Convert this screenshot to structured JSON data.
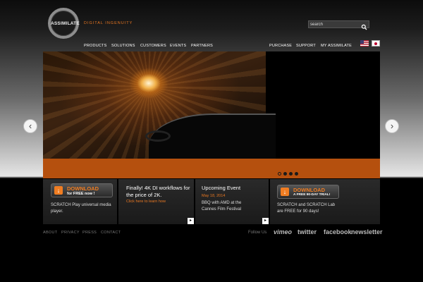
{
  "header": {
    "logo_text": "ASSIMILATE",
    "tagline": "DIGITAL INGENUITY",
    "search": {
      "placeholder": "search",
      "value": ""
    }
  },
  "nav": {
    "left": [
      "PRODUCTS",
      "SOLUTIONS",
      "CUSTOMERS",
      "EVENTS",
      "PARTNERS"
    ],
    "right": [
      "PURCHASE",
      "SUPPORT",
      "MY ASSIMILATE"
    ]
  },
  "slider": {
    "dots_count": 4,
    "active_dot": 0
  },
  "panels": {
    "play": {
      "button_line1": "DOWNLOAD",
      "button_line2": "for FREE now !",
      "text": "SCRATCH Play universal media player."
    },
    "news": {
      "title": "Finally! 4K DI workflows for the price of 2K.",
      "link": "Click here to learn how"
    },
    "event": {
      "title": "Upcoming Event",
      "date": "May 18, 2014",
      "text": "BBQ with AMD at the Cannes Film Festival"
    },
    "trial": {
      "button_line1": "DOWNLOAD",
      "button_line2": "A FREE 90-DAY TRIAL!",
      "text": "SCRATCH and SCRATCH Lab are FREE for 90 days!"
    }
  },
  "footer": {
    "links": [
      "ABOUT",
      "PRIVACY",
      "PRESS",
      "CONTACT"
    ],
    "follow_label": "Follow Us",
    "social": [
      "vimeo",
      "twitter",
      "facebook",
      "newsletter"
    ]
  },
  "colors": {
    "accent": "#e87722",
    "band": "#b5500e"
  }
}
